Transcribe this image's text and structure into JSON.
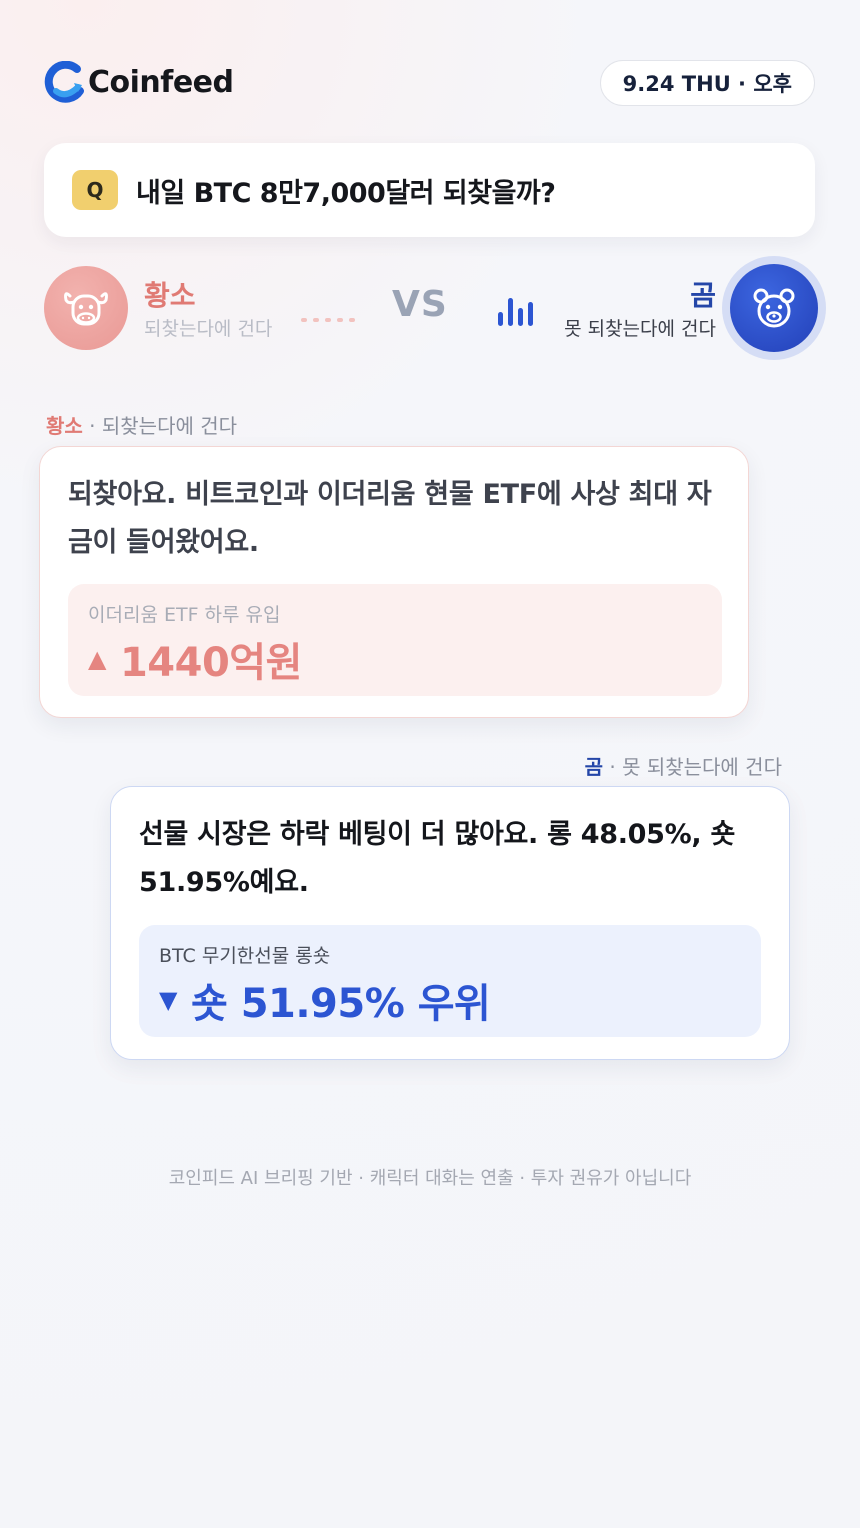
{
  "header": {
    "brand": "Coinfeed",
    "date": "9.24 THU · 오후"
  },
  "question": {
    "badge": "Q",
    "text": "내일 BTC 8만7,000달러 되찾을까?"
  },
  "versus": {
    "bull_name": "황소",
    "bull_sub": "되찾는다에 건다",
    "vs": "VS",
    "bear_name": "곰",
    "bear_sub": "못 되찾는다에 건다"
  },
  "bull_card": {
    "speaker": "황소",
    "speaker_sub": " · 되찾는다에 건다",
    "text": "되찾아요. 비트코인과 이더리움 현물 ETF에 사상 최대 자금이 들어왔어요.",
    "stat_label": "이더리움 ETF 하루 유입",
    "stat_arrow": "▲",
    "stat_value": "1440억원",
    "accent": "#e07a74"
  },
  "bear_card": {
    "speaker": "곰",
    "speaker_sub": " · 못 되찾는다에 건다",
    "text": "선물 시장은 하락 베팅이 더 많아요. 롱 48.05%, 숏 51.95%예요.",
    "stat_label": "BTC 무기한선물 롱숏",
    "stat_arrow": "▼",
    "stat_value": "숏 51.95% 우위",
    "accent": "#2c55d2"
  },
  "footer": {
    "disclaimer": "코인피드 AI 브리핑 기반 · 캐릭터 대화는 연출 · 투자 권유가 아닙니다"
  },
  "icons": {
    "logo": "coinfeed-logo-icon",
    "bull": "bull-icon",
    "bear": "bear-icon",
    "bars": "signal-bars-icon"
  }
}
